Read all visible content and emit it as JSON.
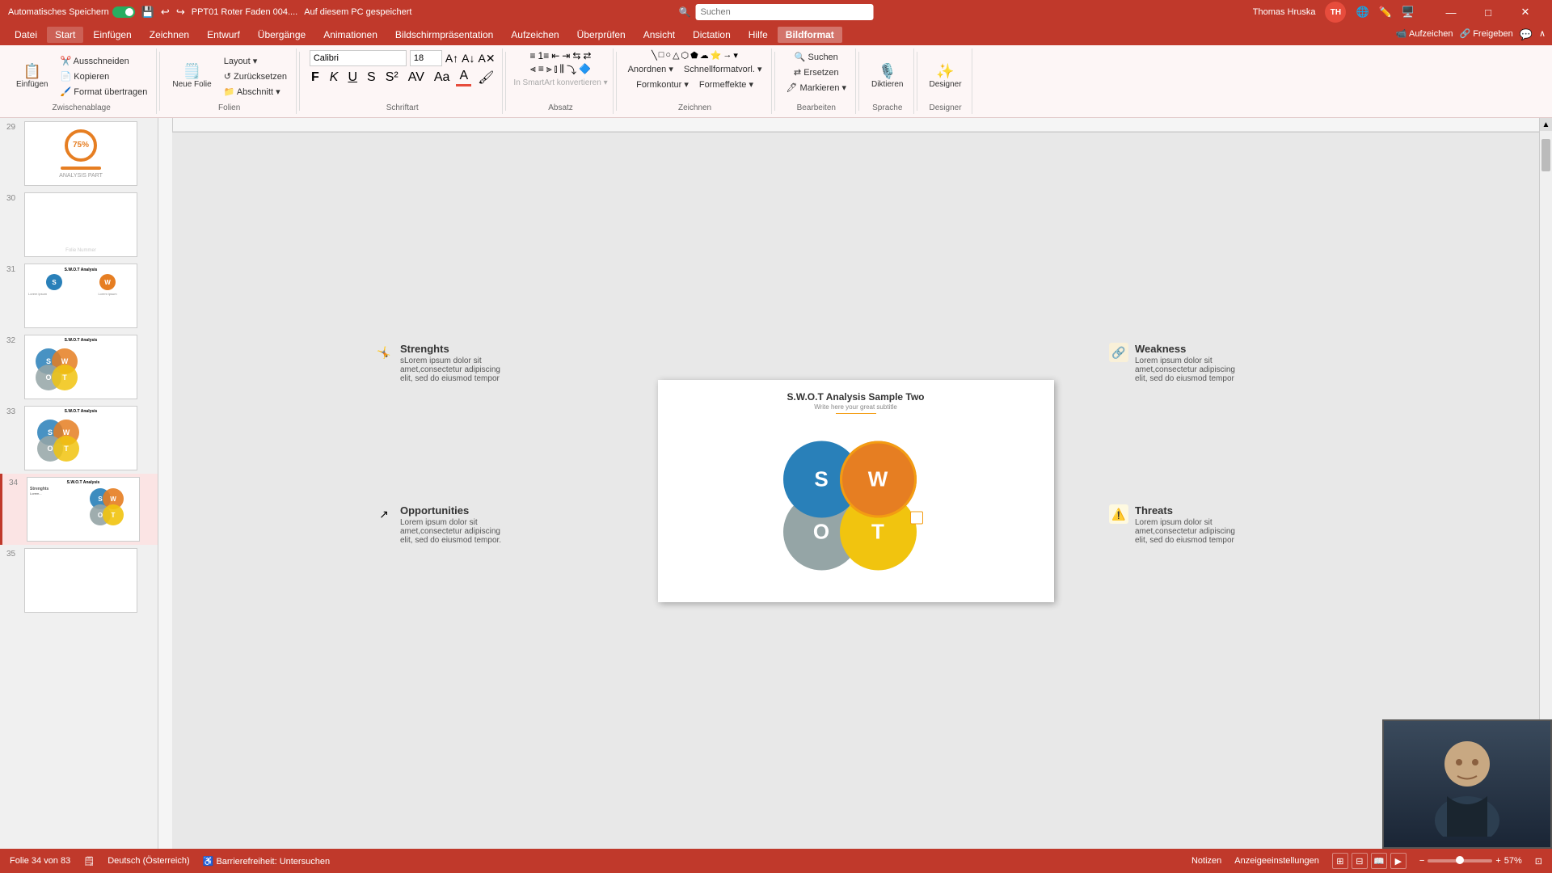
{
  "titlebar": {
    "autosave_label": "Automatisches Speichern",
    "file_name": "PPT01 Roter Faden 004....",
    "save_location": "Auf diesem PC gespeichert",
    "user_name": "Thomas Hruska",
    "user_initials": "TH",
    "search_placeholder": "Suchen",
    "win_minimize": "—",
    "win_maximize": "□",
    "win_close": "✕"
  },
  "menubar": {
    "items": [
      "Datei",
      "Start",
      "Einfügen",
      "Zeichnen",
      "Entwurf",
      "Übergänge",
      "Animationen",
      "Bildschirmpräsentation",
      "Aufzeichen",
      "Überprüfen",
      "Ansicht",
      "Dictation",
      "Hilfe",
      "Bildformat"
    ]
  },
  "ribbon": {
    "groups": [
      {
        "label": "Zwischenablage",
        "buttons": [
          "Einfügen",
          "Ausschneiden",
          "Kopieren",
          "Format übertragen"
        ]
      },
      {
        "label": "Folien",
        "buttons": [
          "Neue Folie",
          "Layout",
          "Zurücksetzen",
          "Abschnitt"
        ]
      },
      {
        "label": "Schriftart",
        "buttons": [
          "F",
          "K",
          "U",
          "S"
        ]
      },
      {
        "label": "Absatz",
        "buttons": [
          "≡",
          "≡",
          "≡"
        ]
      },
      {
        "label": "Zeichnen",
        "buttons": [
          "□",
          "○",
          "△"
        ]
      },
      {
        "label": "Bearbeiten",
        "buttons": [
          "Suchen",
          "Ersetzen",
          "Markieren"
        ]
      },
      {
        "label": "Sprache",
        "buttons": [
          "Diktieren"
        ]
      },
      {
        "label": "Designer",
        "buttons": [
          "Designer"
        ]
      }
    ],
    "diktieren_label": "Diktieren",
    "designer_label": "Designer"
  },
  "statusbar": {
    "slide_info": "Folie 34 von 83",
    "language": "Deutsch (Österreich)",
    "accessibility": "Barrierefreiheit: Untersuchen",
    "notes_label": "Notizen",
    "display_settings": "Anzeigeeinstellungen",
    "zoom_level": "57%",
    "fit_label": "Anpassen"
  },
  "slide": {
    "title": "S.W.O.T Analysis Sample Two",
    "subtitle": "Write here your great subtitle",
    "swot": {
      "s_letter": "S",
      "w_letter": "W",
      "o_letter": "O",
      "t_letter": "T"
    }
  },
  "ext_labels": {
    "strengths_title": "Strenghts",
    "strengths_text": "sLorem ipsum dolor sit amet,consectetur adipiscing elit, sed do eiusmod tempor",
    "weakness_title": "Weakness",
    "weakness_text": "Lorem ipsum dolor sit amet,consectetur adipiscing elit, sed do eiusmod tempor",
    "opportunities_title": "Opportunities",
    "opportunities_text": "Lorem ipsum dolor sit amet,consectetur adipiscing elit, sed do eiusmod tempor.",
    "threats_title": "Threats",
    "threats_text": "Lorem ipsum dolor sit amet,consectetur adipiscing elit, sed do eiusmod tempor"
  },
  "slides_panel": [
    {
      "num": "29",
      "type": "chart75"
    },
    {
      "num": "30",
      "type": "blank"
    },
    {
      "num": "31",
      "type": "swot_list"
    },
    {
      "num": "32",
      "type": "swot_venn"
    },
    {
      "num": "33",
      "type": "swot_venn2"
    },
    {
      "num": "34",
      "type": "swot_active"
    },
    {
      "num": "35",
      "type": "blank_bottom"
    }
  ],
  "colors": {
    "accent": "#c0392b",
    "blue": "#2980b9",
    "orange": "#e67e22",
    "grey": "#95a5a6",
    "yellow": "#f1c40f",
    "dark": "#333333"
  }
}
